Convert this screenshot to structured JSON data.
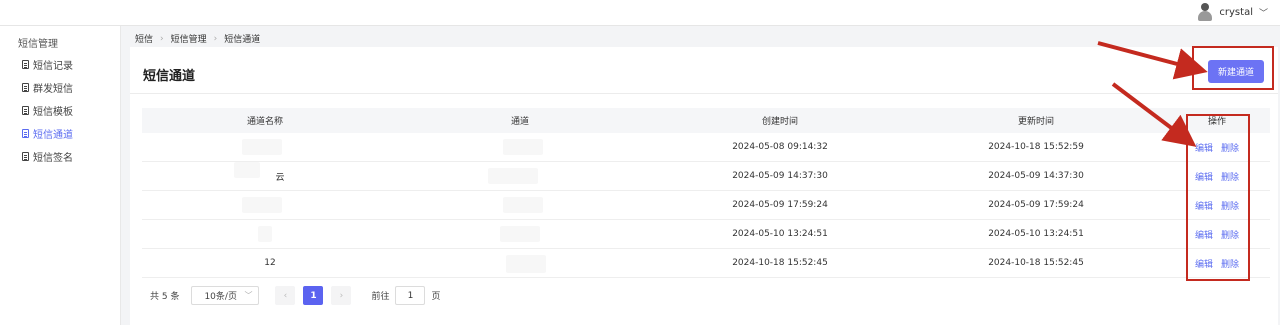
{
  "header": {
    "username": "crystal"
  },
  "sidebar": {
    "title": "短信管理",
    "items": [
      {
        "label": "短信记录"
      },
      {
        "label": "群发短信"
      },
      {
        "label": "短信模板"
      },
      {
        "label": "短信通道",
        "active": true
      },
      {
        "label": "短信签名"
      }
    ]
  },
  "breadcrumb": [
    "短信",
    "短信管理",
    "短信通道"
  ],
  "page": {
    "title": "短信通道",
    "new_button": "新建通道"
  },
  "table": {
    "columns": [
      "通道名称",
      "通道",
      "创建时间",
      "更新时间",
      "操作"
    ],
    "rows": [
      {
        "name": "",
        "channel": "",
        "created": "2024-05-08 09:14:32",
        "updated": "2024-10-18 15:52:59"
      },
      {
        "name": "云",
        "channel": "",
        "created": "2024-05-09 14:37:30",
        "updated": "2024-05-09 14:37:30"
      },
      {
        "name": "",
        "channel": "",
        "created": "2024-05-09 17:59:24",
        "updated": "2024-05-09 17:59:24"
      },
      {
        "name": "",
        "channel": "",
        "created": "2024-05-10 13:24:51",
        "updated": "2024-05-10 13:24:51"
      },
      {
        "name": "12",
        "channel": "",
        "created": "2024-10-18 15:52:45",
        "updated": "2024-10-18 15:52:45"
      }
    ],
    "edit_label": "编辑",
    "delete_label": "删除"
  },
  "pagination": {
    "total": "共 5 条",
    "page_size": "10条/页",
    "current_page": "1",
    "goto_label": "前往",
    "goto_value": "1",
    "page_unit": "页"
  },
  "colors": {
    "accent": "#5b6cf0",
    "annotation": "#c42a1f"
  }
}
